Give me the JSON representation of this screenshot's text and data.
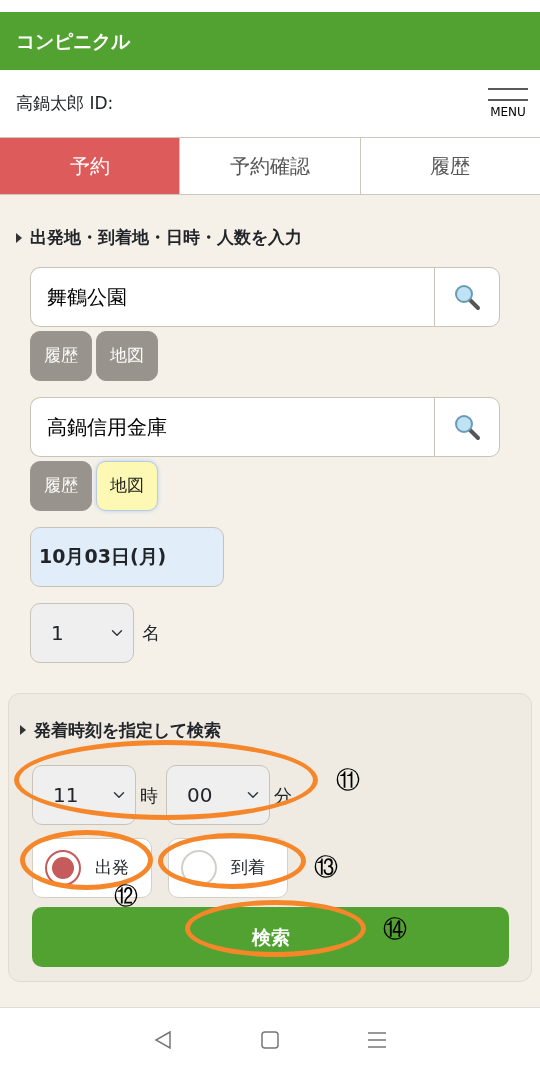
{
  "app_bar": {
    "title": "コンピニクル"
  },
  "user_bar": {
    "user": "高鍋太郎 ID:",
    "menu_label": "MENU"
  },
  "tabs": [
    {
      "label": "予約",
      "selected": true
    },
    {
      "label": "予約確認",
      "selected": false
    },
    {
      "label": "履歴",
      "selected": false
    }
  ],
  "input_section": {
    "heading": "出発地・到着地・日時・人数を入力",
    "places": [
      {
        "value": "舞鶴公園",
        "buttons": [
          {
            "label": "履歴",
            "selected": false
          },
          {
            "label": "地図",
            "selected": false
          }
        ]
      },
      {
        "value": "高鍋信用金庫",
        "buttons": [
          {
            "label": "履歴",
            "selected": false
          },
          {
            "label": "地図",
            "selected": true
          }
        ]
      }
    ],
    "date": "10月03日(月)",
    "people": {
      "value": "1",
      "unit": "名"
    }
  },
  "time_section": {
    "heading": "発着時刻を指定して検索",
    "hour": {
      "value": "11",
      "unit": "時"
    },
    "minute": {
      "value": "00",
      "unit": "分"
    },
    "modes": [
      {
        "label": "出発",
        "selected": true
      },
      {
        "label": "到着",
        "selected": false
      }
    ],
    "search_button": "検索"
  },
  "annotations": [
    {
      "label": "⑪"
    },
    {
      "label": "⑫"
    },
    {
      "label": "⑬"
    },
    {
      "label": "⑭"
    }
  ]
}
